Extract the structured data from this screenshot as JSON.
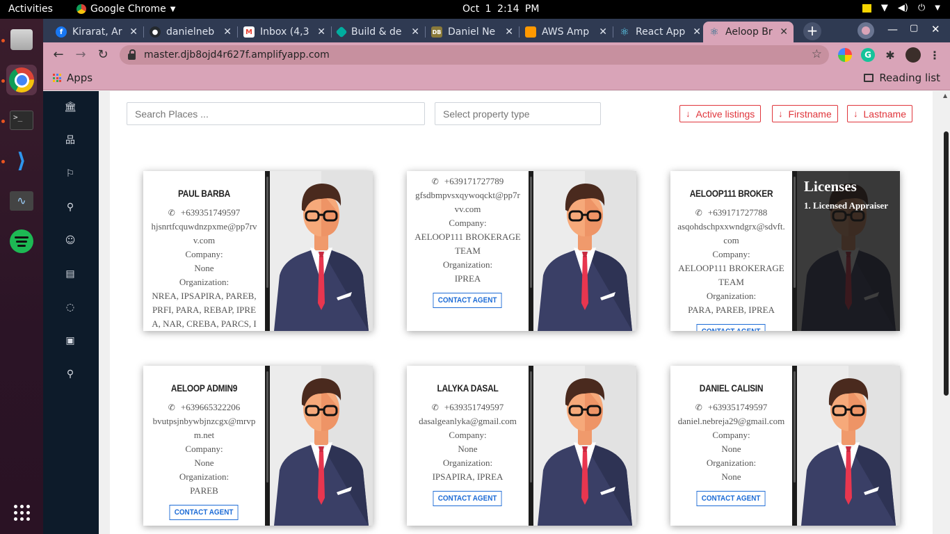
{
  "topbar": {
    "activities": "Activities",
    "app_name": "Google Chrome",
    "clock_date": "Oct 1",
    "clock_time": "2:14 PM"
  },
  "tabs": [
    {
      "title": "Kirarat, Ar",
      "icon": "facebook-icon",
      "color": "#1877f2"
    },
    {
      "title": "danielneb",
      "icon": "github-icon",
      "color": "#24292e"
    },
    {
      "title": "Inbox (4,3",
      "icon": "gmail-icon",
      "color": "#ea4335"
    },
    {
      "title": "Build & de",
      "icon": "netlify-icon",
      "color": "#00ad9f"
    },
    {
      "title": "Daniel Ne",
      "icon": "aws-docs-icon",
      "color": "#8a7a3a"
    },
    {
      "title": "AWS Amp",
      "icon": "aws-amplify-icon",
      "color": "#f90"
    },
    {
      "title": "React App",
      "icon": "react-icon",
      "color": "#61dafb"
    },
    {
      "title": "Aeloop Br",
      "icon": "react-icon",
      "color": "#61dafb"
    }
  ],
  "address_bar": {
    "url": "master.djb8ojd4r627f.amplifyapp.com"
  },
  "bookmarks": {
    "apps": "Apps",
    "reading_list": "Reading list"
  },
  "filters": {
    "search_placeholder": "Search Places ...",
    "type_placeholder": "Select property type",
    "sort_active": "Active listings",
    "sort_firstname": "Firstname",
    "sort_lastname": "Lastname"
  },
  "labels": {
    "company": "Company:",
    "organization": "Organization:",
    "contact": "CONTACT AGENT",
    "licenses_title": "Licenses",
    "licenses_item": "1. Licensed Appraiser"
  },
  "agents": [
    {
      "name": "PAUL BARBA",
      "phone": "+639351749597",
      "email": "hjsnrtfcquwdnzpxme@pp7rvv.com",
      "company": "None",
      "organization": "NREA, IPSAPIRA, PAREB, PRFI, PARA, REBAP, IPREA, NAR, CREBA, PARCS, I"
    },
    {
      "name": "",
      "phone": "+639171727789",
      "email": "gfsdbmpvsxqywoqckt@pp7rvv.com",
      "company": "AELOOP111 BROKERAGE TEAM",
      "organization": "IPREA"
    },
    {
      "name": "AELOOP111 BROKER",
      "phone": "+639171727788",
      "email": "asqohdschpxxwndgrx@sdvft.com",
      "company": "AELOOP111 BROKERAGE TEAM",
      "organization": "PARA, PAREB, IPREA"
    },
    {
      "name": "AELOOP ADMIN9",
      "phone": "+639665322206",
      "email": "bvutpsjnbywbjnzcgx@mrvpm.net",
      "company": "None",
      "organization": "PAREB"
    },
    {
      "name": "LALYKA DASAL",
      "phone": "+639351749597",
      "email": "dasalgeanlyka@gmail.com",
      "company": "None",
      "organization": "IPSAPIRA, IPREA"
    },
    {
      "name": "DANIEL CALISIN",
      "phone": "+639351749597",
      "email": "daniel.nebreja29@gmail.com",
      "company": "None",
      "organization": "None"
    }
  ],
  "colors": {
    "accent": "#e0353b",
    "link": "#1c6bd6",
    "sidebar": "#0d1b2a",
    "browser_frame": "#d9a4b8"
  }
}
